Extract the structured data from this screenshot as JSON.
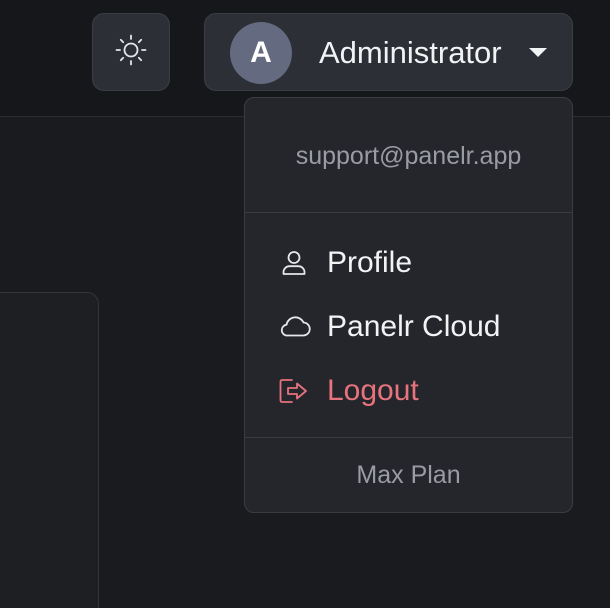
{
  "header": {
    "theme_toggle_icon": "sun-icon",
    "user": {
      "avatar_initial": "A",
      "name": "Administrator",
      "caret_icon": "caret-down-icon"
    }
  },
  "user_menu": {
    "email": "support@panelr.app",
    "items": [
      {
        "label": "Profile",
        "icon": "user-icon"
      },
      {
        "label": "Panelr Cloud",
        "icon": "cloud-icon"
      },
      {
        "label": "Logout",
        "icon": "logout-icon",
        "color": "#e6737d"
      }
    ],
    "plan": "Max Plan"
  },
  "colors": {
    "background": "#1a1b1e",
    "surface": "#25262b",
    "avatar": "#646b80",
    "danger": "#e6737d"
  }
}
